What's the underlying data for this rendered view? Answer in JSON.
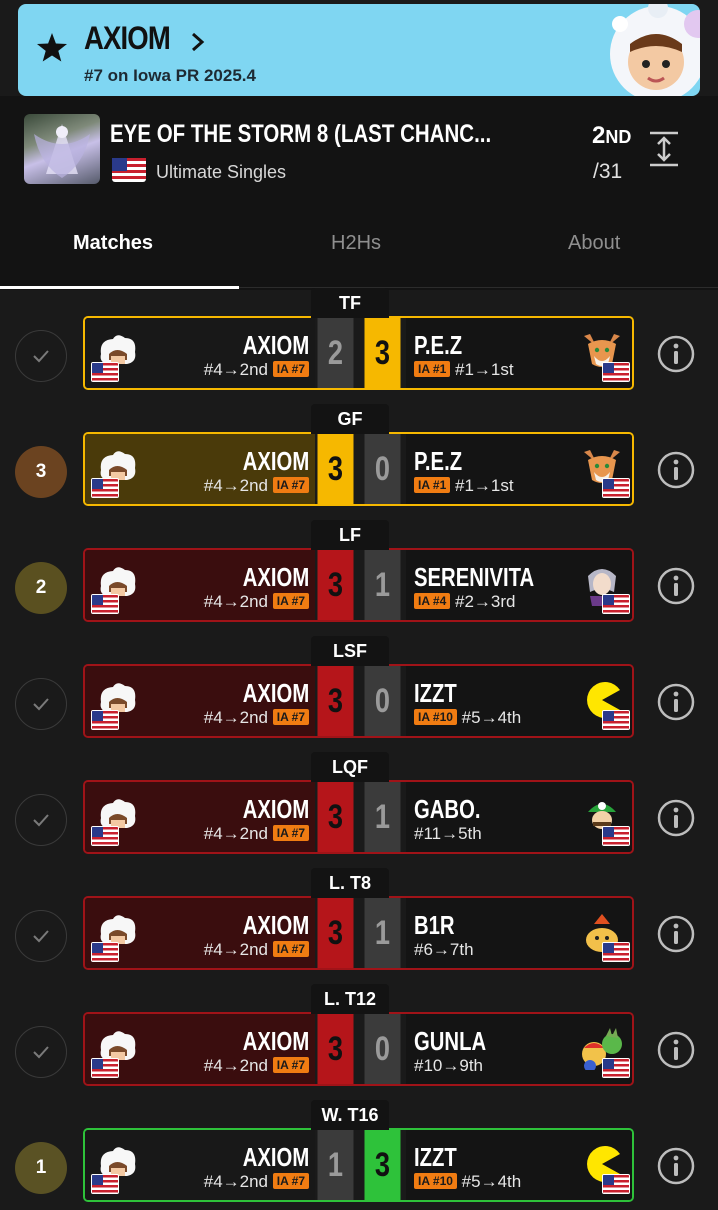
{
  "banner": {
    "player_name": "AXIOM",
    "ranking": "#7 on Iowa PR 2025.4",
    "icons": [
      "star-icon",
      "chevron-right-icon",
      "ice-climber-mascot"
    ]
  },
  "event": {
    "title": "EYE OF THE STORM 8 (LAST CHANC...",
    "game": "Ultimate Singles",
    "placement": "2",
    "placement_suffix": "ND",
    "entrants": "/31",
    "tabs": [
      "Matches",
      "H2Hs",
      "About"
    ],
    "active_tab": "Matches"
  },
  "matches": [
    {
      "round": "TF",
      "status": "check",
      "left": {
        "name": "AXIOM",
        "seed": "#4→2nd",
        "badge": "IA #7",
        "score": "2"
      },
      "right": {
        "name": "P.E.Z",
        "seed": "#1→1st",
        "badge": "IA #1",
        "score": "3"
      },
      "theme": "gold",
      "winner": "right"
    },
    {
      "round": "GF",
      "status": "3",
      "left": {
        "name": "AXIOM",
        "seed": "#4→2nd",
        "badge": "IA #7",
        "score": "3"
      },
      "right": {
        "name": "P.E.Z",
        "seed": "#1→1st",
        "badge": "IA #1",
        "score": "0"
      },
      "theme": "gold",
      "winner": "left"
    },
    {
      "round": "LF",
      "status": "2",
      "left": {
        "name": "AXIOM",
        "seed": "#4→2nd",
        "badge": "IA #7",
        "score": "3"
      },
      "right": {
        "name": "SERENIVITA",
        "seed": "#2→3rd",
        "badge": "IA #4",
        "score": "1"
      },
      "theme": "red",
      "winner": "left"
    },
    {
      "round": "LSF",
      "status": "check",
      "left": {
        "name": "AXIOM",
        "seed": "#4→2nd",
        "badge": "IA #7",
        "score": "3"
      },
      "right": {
        "name": "IZZT",
        "seed": "#5→4th",
        "badge": "IA #10",
        "score": "0"
      },
      "theme": "red",
      "winner": "left"
    },
    {
      "round": "LQF",
      "status": "check",
      "left": {
        "name": "AXIOM",
        "seed": "#4→2nd",
        "badge": "IA #7",
        "score": "3"
      },
      "right": {
        "name": "GABO.",
        "seed": "#11→5th",
        "badge": "",
        "score": "1"
      },
      "theme": "red",
      "winner": "left"
    },
    {
      "round": "L. T8",
      "status": "check",
      "left": {
        "name": "AXIOM",
        "seed": "#4→2nd",
        "badge": "IA #7",
        "score": "3"
      },
      "right": {
        "name": "B1R",
        "seed": "#6→7th",
        "badge": "",
        "score": "1"
      },
      "theme": "red",
      "winner": "left"
    },
    {
      "round": "L. T12",
      "status": "check",
      "left": {
        "name": "AXIOM",
        "seed": "#4→2nd",
        "badge": "IA #7",
        "score": "3"
      },
      "right": {
        "name": "GUNLA",
        "seed": "#10→9th",
        "badge": "",
        "score": "0"
      },
      "theme": "red",
      "winner": "left"
    },
    {
      "round": "W. T16",
      "status": "1",
      "left": {
        "name": "AXIOM",
        "seed": "#4→2nd",
        "badge": "IA #7",
        "score": "1"
      },
      "right": {
        "name": "IZZT",
        "seed": "#5→4th",
        "badge": "IA #10",
        "score": "3"
      },
      "theme": "green",
      "winner": "right"
    }
  ],
  "colors": {
    "gold": "#f6b800",
    "red": "#b5151a",
    "green": "#2ec23a",
    "badge": "#f07c12",
    "banner": "#7fd6f2"
  }
}
